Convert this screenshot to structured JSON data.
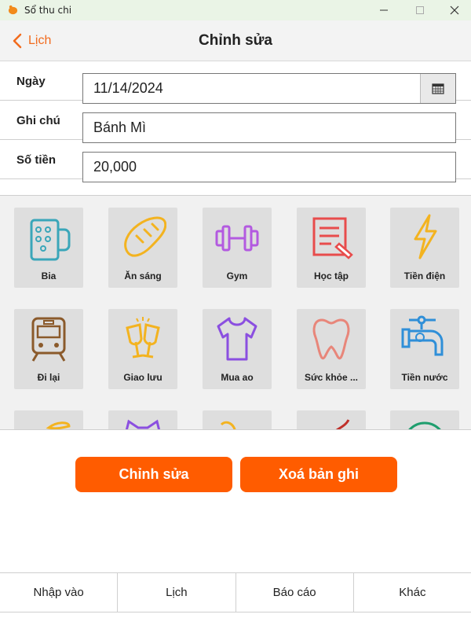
{
  "window": {
    "title": "Sổ thu chi"
  },
  "header": {
    "back_label": "Lịch",
    "title": "Chỉnh sửa"
  },
  "form": {
    "date": {
      "label": "Ngày",
      "value": "11/14/2024"
    },
    "note": {
      "label": "Ghi chú",
      "value": "Bánh Mì"
    },
    "amount": {
      "label": "Số tiền",
      "value": "20,000"
    }
  },
  "categories": [
    {
      "label": "Bia",
      "icon": "beer-icon"
    },
    {
      "label": "Ăn sáng",
      "icon": "bread-icon"
    },
    {
      "label": "Gym",
      "icon": "dumbbell-icon"
    },
    {
      "label": "Học tập",
      "icon": "study-icon"
    },
    {
      "label": "Tiền điện",
      "icon": "lightning-icon"
    },
    {
      "label": "Đi lại",
      "icon": "train-icon"
    },
    {
      "label": "Giao lưu",
      "icon": "cheers-icon"
    },
    {
      "label": "Mua ao",
      "icon": "shirt-icon"
    },
    {
      "label": "Sức khỏe ...",
      "icon": "tooth-icon"
    },
    {
      "label": "Tiền nước",
      "icon": "water-tap-icon"
    }
  ],
  "actions": {
    "edit_label": "Chỉnh sửa",
    "delete_label": "Xoá bản ghi"
  },
  "nav": {
    "input": "Nhập vào",
    "calendar": "Lịch",
    "report": "Báo cáo",
    "other": "Khác"
  },
  "colors": {
    "accent": "#ff5c00",
    "link": "#f26b1d"
  }
}
